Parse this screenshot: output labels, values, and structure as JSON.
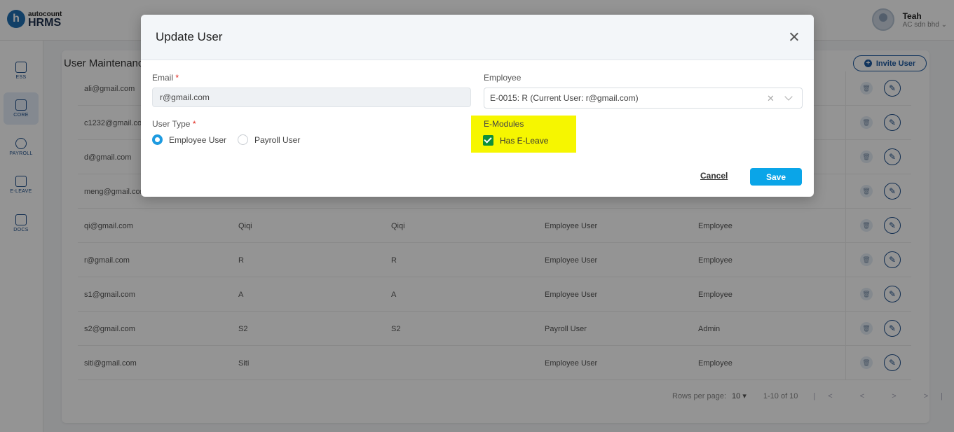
{
  "header": {
    "logo_small": "autocount",
    "logo_big": "HRMS",
    "user_name": "Teah",
    "company": "AC sdn bhd ⌄"
  },
  "sidebar": {
    "items": [
      {
        "label": "ESS",
        "icon": "ess-icon"
      },
      {
        "label": "CORE",
        "icon": "core-icon"
      },
      {
        "label": "PAYROLL",
        "icon": "payroll-icon"
      },
      {
        "label": "E-LEAVE",
        "icon": "calendar-icon"
      },
      {
        "label": "DOCS",
        "icon": "docs-icon"
      }
    ]
  },
  "page": {
    "title": "User Maintenance",
    "invite_label": "Invite User"
  },
  "table": {
    "rows": [
      {
        "email": "ali@gmail.com",
        "name": "",
        "name2": "",
        "type": "",
        "role": ""
      },
      {
        "email": "c1232@gmail.com",
        "name": "",
        "name2": "",
        "type": "",
        "role": ""
      },
      {
        "email": "d@gmail.com",
        "name": "",
        "name2": "",
        "type": "",
        "role": ""
      },
      {
        "email": "meng@gmail.com",
        "name": "",
        "name2": "",
        "type": "",
        "role": ""
      },
      {
        "email": "qi@gmail.com",
        "name": "Qiqi",
        "name2": "Qiqi",
        "type": "Employee User",
        "role": "Employee"
      },
      {
        "email": "r@gmail.com",
        "name": "R",
        "name2": "R",
        "type": "Employee User",
        "role": "Employee"
      },
      {
        "email": "s1@gmail.com",
        "name": "A",
        "name2": "A",
        "type": "Employee User",
        "role": "Employee"
      },
      {
        "email": "s2@gmail.com",
        "name": "S2",
        "name2": "S2",
        "type": "Payroll User",
        "role": "Admin"
      },
      {
        "email": "siti@gmail.com",
        "name": "Siti",
        "name2": "",
        "type": "Employee User",
        "role": "Employee"
      }
    ]
  },
  "pagination": {
    "rows_per_page_label": "Rows per page:",
    "rows_per_page_value": "10 ▾",
    "range": "1-10 of 10",
    "nav": "|< < > >|"
  },
  "modal": {
    "title": "Update User",
    "email_label": "Email",
    "email_value": "r@gmail.com",
    "employee_label": "Employee",
    "employee_value": "E-0015: R (Current User: r@gmail.com)",
    "user_type_label": "User Type",
    "options": [
      "Employee User",
      "Payroll User"
    ],
    "selected_option": "Employee User",
    "emodules_label": "E-Modules",
    "has_eleave_label": "Has E-Leave",
    "has_eleave_checked": true,
    "cancel_label": "Cancel",
    "save_label": "Save",
    "highlight_color": "#f6f600"
  }
}
